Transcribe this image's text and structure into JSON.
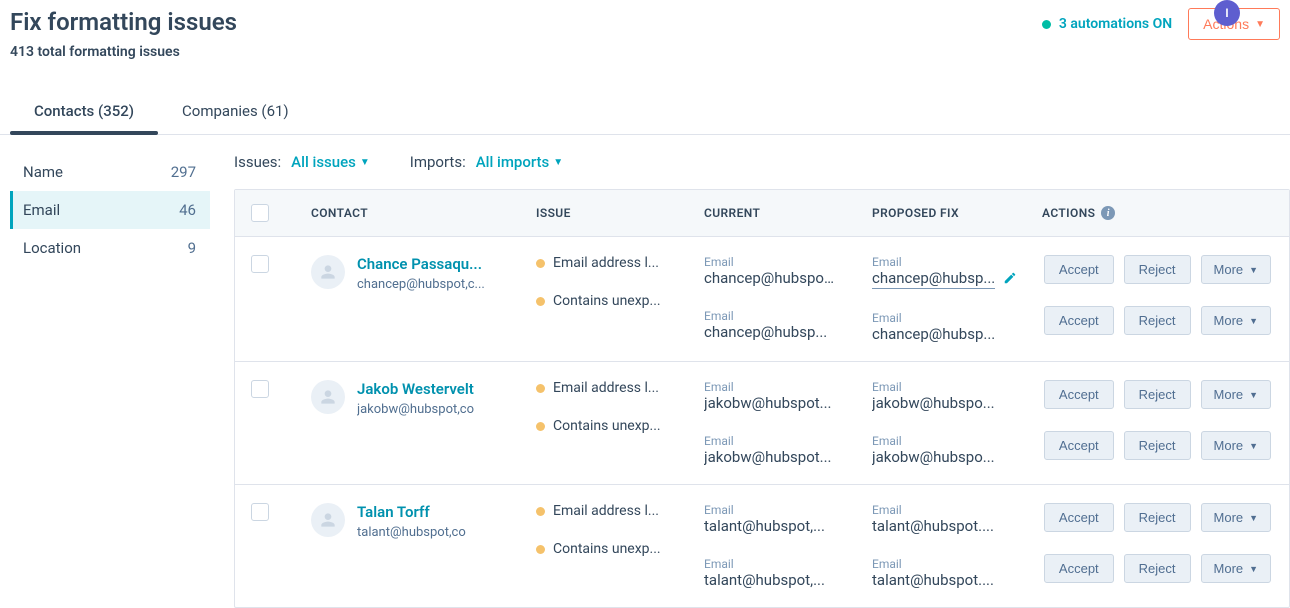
{
  "header": {
    "title": "Fix formatting issues",
    "subtitle": "413 total formatting issues",
    "automations_label": "3 automations ON",
    "actions_btn": "Actions",
    "avatar_initial": "I"
  },
  "tabs": [
    {
      "label": "Contacts (352)",
      "active": true
    },
    {
      "label": "Companies (61)",
      "active": false
    }
  ],
  "sidebar": [
    {
      "label": "Name",
      "count": "297",
      "active": false
    },
    {
      "label": "Email",
      "count": "46",
      "active": true
    },
    {
      "label": "Location",
      "count": "9",
      "active": false
    }
  ],
  "filters": {
    "issues_label": "Issues:",
    "issues_value": "All issues",
    "imports_label": "Imports:",
    "imports_value": "All imports"
  },
  "columns": {
    "contact": "CONTACT",
    "issue": "ISSUE",
    "current": "CURRENT",
    "proposed": "PROPOSED FIX",
    "actions": "ACTIONS"
  },
  "buttons": {
    "accept": "Accept",
    "reject": "Reject",
    "more": "More"
  },
  "value_label": "Email",
  "rows": [
    {
      "name": "Chance Passaqu...",
      "email": "chancep@hubspot,c...",
      "issues": [
        "Email address l...",
        "Contains unexp..."
      ],
      "current": [
        "chancep@hubspo...",
        "chancep@hubsp..."
      ],
      "proposed": [
        "chancep@hubsp...",
        "chancep@hubsp..."
      ],
      "first_editable": true
    },
    {
      "name": "Jakob Westervelt",
      "email": "jakobw@hubspot,co",
      "issues": [
        "Email address l...",
        "Contains unexp..."
      ],
      "current": [
        "jakobw@hubspot...",
        "jakobw@hubspot..."
      ],
      "proposed": [
        "jakobw@hubspo...",
        "jakobw@hubspo..."
      ],
      "first_editable": false
    },
    {
      "name": "Talan Torff",
      "email": "talant@hubspot,co",
      "issues": [
        "Email address l...",
        "Contains unexp..."
      ],
      "current": [
        "talant@hubspot,...",
        "talant@hubspot,..."
      ],
      "proposed": [
        "talant@hubspot....",
        "talant@hubspot...."
      ],
      "first_editable": false
    }
  ]
}
